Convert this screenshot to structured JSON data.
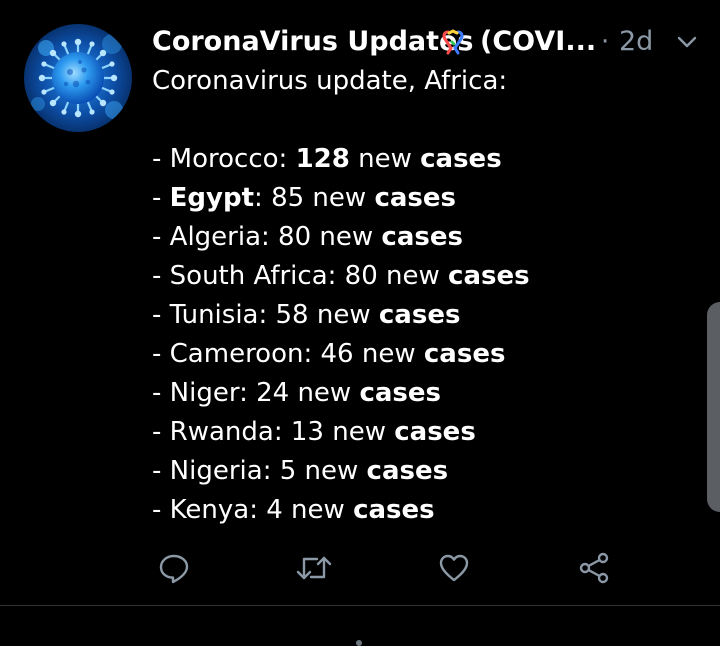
{
  "tweet": {
    "display_name": "CoronaVirus Updates",
    "name_rest": "(COVI...",
    "dot_separator": "·",
    "time": "2d",
    "intro": "Coronavirus update, Africa:",
    "avatar_icon": "virus-avatar-icon",
    "badge_icon": "ribbon-emoji-icon"
  },
  "cases": [
    {
      "dash": "- ",
      "country": "Morocco",
      "country_bold": false,
      "count": "128",
      "count_bold": true,
      "mid": " new ",
      "word": "cases"
    },
    {
      "dash": "- ",
      "country": "Egypt",
      "country_bold": true,
      "count": "85",
      "count_bold": false,
      "mid": " new ",
      "word": "cases"
    },
    {
      "dash": "- ",
      "country": "Algeria",
      "country_bold": false,
      "count": "80",
      "count_bold": false,
      "mid": " new ",
      "word": "cases"
    },
    {
      "dash": "- ",
      "country": "South Africa",
      "country_bold": false,
      "count": "80",
      "count_bold": false,
      "mid": " new ",
      "word": "cases"
    },
    {
      "dash": "- ",
      "country": "Tunisia",
      "country_bold": false,
      "count": "58",
      "count_bold": false,
      "mid": " new ",
      "word": "cases"
    },
    {
      "dash": "- ",
      "country": "Cameroon",
      "country_bold": false,
      "count": "46",
      "count_bold": false,
      "mid": " new ",
      "word": "cases"
    },
    {
      "dash": "- ",
      "country": "Niger",
      "country_bold": false,
      "count": "24",
      "count_bold": false,
      "mid": " new ",
      "word": "cases"
    },
    {
      "dash": "- ",
      "country": "Rwanda",
      "country_bold": false,
      "count": "13",
      "count_bold": false,
      "mid": " new ",
      "word": "cases"
    },
    {
      "dash": "- ",
      "country": "Nigeria",
      "country_bold": false,
      "count": "5",
      "count_bold": false,
      "mid": " new ",
      "word": "cases"
    },
    {
      "dash": "- ",
      "country": "Kenya",
      "country_bold": false,
      "count": "4",
      "count_bold": false,
      "mid": " new ",
      "word": "cases"
    }
  ],
  "actions": {
    "reply_icon": "reply-icon",
    "retweet_icon": "retweet-icon",
    "like_icon": "heart-icon",
    "share_icon": "share-icon"
  },
  "colors": {
    "background": "#000000",
    "text": "#ffffff",
    "secondary": "#8b98a5",
    "icon": "#8b98a5",
    "divider": "#2f3336"
  }
}
